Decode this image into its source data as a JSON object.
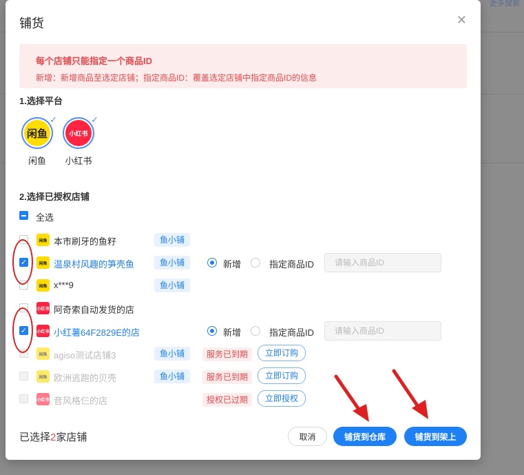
{
  "background": {
    "more_link": "更多搜索"
  },
  "modal": {
    "title": "铺货",
    "close_icon": "close-icon"
  },
  "alert": {
    "title": "每个店铺只能指定一个商品ID",
    "description": "新增：新增商品至选定店铺；指定商品ID：覆盖选定店铺中指定商品ID的信息"
  },
  "platform_section": {
    "title": "1.选择平台",
    "platforms": [
      {
        "label": "闲鱼",
        "logo_text": "闲鱼",
        "selected": true
      },
      {
        "label": "小红书",
        "logo_text": "小红书",
        "selected": true
      }
    ]
  },
  "shop_section": {
    "title": "2.选择已授权店铺",
    "select_all_label": "全选",
    "shops": [
      {
        "name": "本市刷牙的鱼籽",
        "platform": "闲鱼",
        "type_tag": "鱼小铺",
        "checked": false
      },
      {
        "name": "温泉村风趣的笋壳鱼",
        "platform": "闲鱼",
        "type_tag": "鱼小铺",
        "checked": true,
        "mode_new": "新增",
        "mode_specify": "指定商品ID",
        "input_placeholder": "请输入商品ID"
      },
      {
        "name": "x***9",
        "platform": "闲鱼",
        "type_tag": "鱼小铺",
        "checked": false
      },
      {
        "name": "阿奇索自动发货的店",
        "platform": "小红书",
        "checked": false
      },
      {
        "name": "小红薯64F2829E的店",
        "platform": "小红书",
        "checked": true,
        "mode_new": "新增",
        "mode_specify": "指定商品ID",
        "input_placeholder": "请输入商品ID"
      },
      {
        "name": "agiso测试店铺3",
        "platform": "闲鱼",
        "type_tag": "鱼小铺",
        "status": "服务已到期",
        "action": "立即订购",
        "disabled": true
      },
      {
        "name": "欧洲逃跑的贝壳",
        "platform": "闲鱼",
        "type_tag": "鱼小铺",
        "status": "服务已到期",
        "action": "立即订购",
        "disabled": true
      },
      {
        "name": "音风格仨的店",
        "platform": "小红书",
        "status": "授权已过期",
        "action": "立即授权",
        "disabled": true
      }
    ]
  },
  "footer": {
    "count_prefix": "已选择",
    "count": "2",
    "count_suffix": "家店铺",
    "cancel": "取消",
    "to_warehouse": "铺货到仓库",
    "to_shelf": "铺货到架上"
  },
  "colors": {
    "accent": "#1d80f5",
    "danger": "#e5484d",
    "annotation": "#e02020"
  }
}
